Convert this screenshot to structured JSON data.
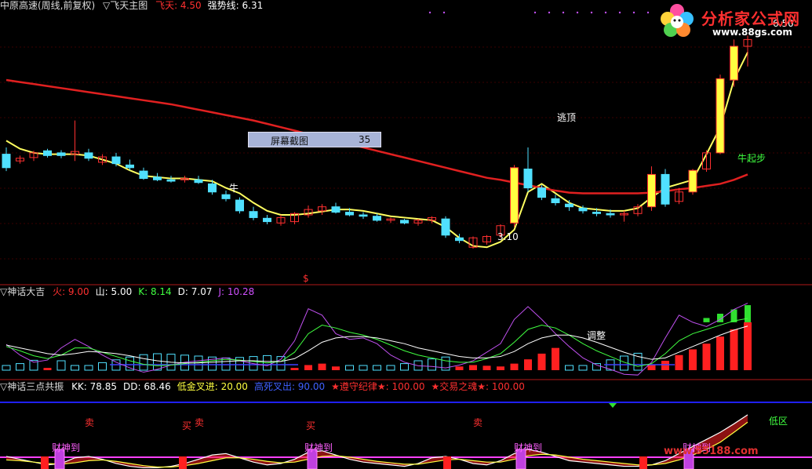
{
  "panel1": {
    "title": "中原高速(周线,前复权)",
    "indicator": "▽飞天主图",
    "fields": [
      {
        "label": "飞天:",
        "value": "4.50",
        "color": "#ff3030"
      },
      {
        "label": "强势线:",
        "value": "6.31",
        "color": "#ffffff"
      }
    ],
    "annotations": {
      "escape_top": "逃顶",
      "bull_start": "牛起步",
      "bull_mark": "牛",
      "low_price": "3.10",
      "high_price": "6.50"
    },
    "screenshot_button": {
      "label": "屏幕截图",
      "value": "35"
    },
    "marker": "$"
  },
  "panel2": {
    "title": "▽神话大吉",
    "fields": [
      {
        "label": "火:",
        "value": "9.00",
        "color": "#ff3030"
      },
      {
        "label": "山:",
        "value": "5.00",
        "color": "#ffffff"
      },
      {
        "label": "K:",
        "value": "8.14",
        "color": "#40ff40"
      },
      {
        "label": "D:",
        "value": "7.07",
        "color": "#ffffff"
      },
      {
        "label": "J:",
        "value": "10.28",
        "color": "#d050ff"
      }
    ],
    "annotation": "调整"
  },
  "panel3": {
    "title": "▽神话三点共振",
    "fields": [
      {
        "label": "KK:",
        "value": "78.85",
        "color": "#ffffff"
      },
      {
        "label": "DD:",
        "value": "68.46",
        "color": "#ffffff"
      },
      {
        "label": "低金叉进:",
        "value": "20.00",
        "color": "#ffff40"
      },
      {
        "label": "高死叉出:",
        "value": "90.00",
        "color": "#4060ff"
      },
      {
        "label": "★遵守纪律★:",
        "value": "100.00",
        "color": "#ff3030"
      },
      {
        "label": "★交易之魂★:",
        "value": "100.00",
        "color": "#ff3030"
      }
    ],
    "marks": {
      "sell": "卖",
      "buy": "买",
      "wealth": "财神到",
      "zone": "低区"
    }
  },
  "logo": {
    "name": "分析家公式网",
    "url": "www.88gs.com"
  },
  "watermark": "www.55188.com",
  "chart_data": [
    {
      "type": "candlestick",
      "title": "中原高速(周线,前复权)",
      "series": [
        {
          "name": "强势线",
          "color": "#ffff60",
          "values": [
            5.0,
            4.88,
            4.82,
            4.8,
            4.8,
            4.8,
            4.78,
            4.72,
            4.66,
            4.56,
            4.48,
            4.46,
            4.44,
            4.44,
            4.42,
            4.4,
            4.3,
            4.22,
            4.08,
            3.96,
            3.9,
            3.9,
            3.92,
            3.95,
            3.98,
            3.98,
            3.96,
            3.92,
            3.88,
            3.86,
            3.84,
            3.82,
            3.72,
            3.56,
            3.44,
            3.42,
            3.5,
            3.68,
            4.24,
            4.36,
            4.22,
            4.08,
            4.0,
            3.98,
            3.96,
            3.96,
            4.0,
            4.16,
            4.3,
            4.36,
            4.42,
            4.8,
            5.2,
            5.9,
            6.31
          ]
        },
        {
          "name": "飞天",
          "color": "#e02020",
          "values": [
            5.9,
            5.87,
            5.84,
            5.81,
            5.78,
            5.75,
            5.72,
            5.69,
            5.66,
            5.63,
            5.6,
            5.57,
            5.54,
            5.5,
            5.46,
            5.42,
            5.38,
            5.34,
            5.3,
            5.25,
            5.2,
            5.15,
            5.1,
            5.05,
            5.0,
            4.95,
            4.9,
            4.85,
            4.8,
            4.75,
            4.7,
            4.65,
            4.6,
            4.55,
            4.5,
            4.45,
            4.42,
            4.38,
            4.34,
            4.3,
            4.26,
            4.23,
            4.22,
            4.22,
            4.22,
            4.22,
            4.22,
            4.23,
            4.25,
            4.28,
            4.3,
            4.33,
            4.36,
            4.42,
            4.5
          ]
        }
      ],
      "candles": [
        [
          4.8,
          4.9,
          4.55,
          4.6
        ],
        [
          4.7,
          4.78,
          4.66,
          4.74
        ],
        [
          4.75,
          4.85,
          4.7,
          4.82
        ],
        [
          4.85,
          4.88,
          4.75,
          4.78
        ],
        [
          4.82,
          4.86,
          4.74,
          4.78
        ],
        [
          4.8,
          5.3,
          4.7,
          4.84
        ],
        [
          4.82,
          4.88,
          4.7,
          4.74
        ],
        [
          4.68,
          4.8,
          4.64,
          4.76
        ],
        [
          4.76,
          4.82,
          4.62,
          4.66
        ],
        [
          4.64,
          4.72,
          4.56,
          4.6
        ],
        [
          4.55,
          4.6,
          4.42,
          4.44
        ],
        [
          4.46,
          4.52,
          4.4,
          4.42
        ],
        [
          4.42,
          4.48,
          4.38,
          4.4
        ],
        [
          4.42,
          4.48,
          4.38,
          4.44
        ],
        [
          4.42,
          4.48,
          4.36,
          4.38
        ],
        [
          4.36,
          4.42,
          4.2,
          4.24
        ],
        [
          4.2,
          4.26,
          4.1,
          4.14
        ],
        [
          4.12,
          4.16,
          3.92,
          3.96
        ],
        [
          3.95,
          4.02,
          3.82,
          3.86
        ],
        [
          3.85,
          3.9,
          3.76,
          3.8
        ],
        [
          3.78,
          3.9,
          3.74,
          3.86
        ],
        [
          3.8,
          3.94,
          3.76,
          3.92
        ],
        [
          3.9,
          4.04,
          3.86,
          3.98
        ],
        [
          3.96,
          4.06,
          3.9,
          4.02
        ],
        [
          4.02,
          4.08,
          3.92,
          3.94
        ],
        [
          3.94,
          4.0,
          3.88,
          3.9
        ],
        [
          3.9,
          3.94,
          3.84,
          3.88
        ],
        [
          3.88,
          3.92,
          3.8,
          3.82
        ],
        [
          3.82,
          3.86,
          3.78,
          3.84
        ],
        [
          3.82,
          3.84,
          3.76,
          3.78
        ],
        [
          3.78,
          3.84,
          3.74,
          3.82
        ],
        [
          3.82,
          3.88,
          3.78,
          3.86
        ],
        [
          3.84,
          3.88,
          3.56,
          3.6
        ],
        [
          3.56,
          3.62,
          3.48,
          3.52
        ],
        [
          3.42,
          3.58,
          3.4,
          3.56
        ],
        [
          3.5,
          3.6,
          3.46,
          3.58
        ],
        [
          3.6,
          3.76,
          3.56,
          3.74
        ],
        [
          3.78,
          4.64,
          3.72,
          4.6
        ],
        [
          4.58,
          4.9,
          4.24,
          4.3
        ],
        [
          4.3,
          4.34,
          4.12,
          4.16
        ],
        [
          4.14,
          4.2,
          4.04,
          4.08
        ],
        [
          4.06,
          4.12,
          3.96,
          4.02
        ],
        [
          4.0,
          4.04,
          3.92,
          3.96
        ],
        [
          3.94,
          4.0,
          3.88,
          3.92
        ],
        [
          3.92,
          3.98,
          3.86,
          3.9
        ],
        [
          3.9,
          3.96,
          3.8,
          3.92
        ],
        [
          3.92,
          4.06,
          3.88,
          4.02
        ],
        [
          4.02,
          4.62,
          3.96,
          4.5
        ],
        [
          4.5,
          4.58,
          4.02,
          4.06
        ],
        [
          4.1,
          4.3,
          4.06,
          4.24
        ],
        [
          4.24,
          4.58,
          4.2,
          4.56
        ],
        [
          4.58,
          4.86,
          4.54,
          4.82
        ],
        [
          4.82,
          5.98,
          4.8,
          5.92
        ],
        [
          5.9,
          6.5,
          5.8,
          6.4
        ],
        [
          6.4,
          6.56,
          6.1,
          6.5
        ]
      ],
      "ylim": [
        2.9,
        6.9
      ]
    },
    {
      "type": "bar",
      "title": "▽神话大吉",
      "series": [
        {
          "name": "J",
          "color": "#c050f0",
          "values": [
            4.5,
            3.0,
            2.0,
            2.3,
            4.0,
            5.2,
            4.2,
            3.0,
            2.0,
            1.2,
            0.6,
            1.0,
            1.6,
            2.0,
            2.2,
            2.4,
            2.6,
            2.2,
            1.8,
            1.5,
            2.4,
            5.0,
            9.5,
            8.6,
            6.0,
            5.2,
            5.4,
            4.6,
            3.0,
            2.0,
            1.5,
            1.4,
            1.2,
            1.6,
            2.2,
            3.4,
            4.6,
            8.0,
            9.8,
            8.0,
            6.0,
            4.2,
            2.6,
            1.6,
            1.0,
            0.3,
            0.2,
            2.0,
            5.4,
            8.6,
            7.6,
            7.0,
            8.0,
            9.4,
            10.28
          ]
        },
        {
          "name": "K",
          "color": "#40ff40",
          "values": [
            4.2,
            3.6,
            2.9,
            2.5,
            3.0,
            4.0,
            4.0,
            3.4,
            2.8,
            2.2,
            1.7,
            1.5,
            1.6,
            1.8,
            2.0,
            2.2,
            2.4,
            2.3,
            2.1,
            1.9,
            2.1,
            3.4,
            6.0,
            7.2,
            6.8,
            6.2,
            5.8,
            5.2,
            4.4,
            3.6,
            3.0,
            2.6,
            2.2,
            2.0,
            2.0,
            2.5,
            3.2,
            4.8,
            6.6,
            7.2,
            6.8,
            5.8,
            4.6,
            3.6,
            2.8,
            2.0,
            1.4,
            1.8,
            3.2,
            5.0,
            6.0,
            6.6,
            7.2,
            7.8,
            8.14
          ]
        },
        {
          "name": "D",
          "color": "#ffffff",
          "values": [
            4.4,
            4.0,
            3.6,
            3.2,
            3.0,
            3.2,
            3.5,
            3.4,
            3.2,
            2.9,
            2.5,
            2.2,
            2.0,
            1.9,
            1.9,
            2.0,
            2.1,
            2.2,
            2.2,
            2.1,
            2.1,
            2.5,
            3.6,
            4.8,
            5.4,
            5.6,
            5.6,
            5.4,
            5.0,
            4.6,
            4.0,
            3.6,
            3.2,
            2.8,
            2.6,
            2.6,
            2.8,
            3.5,
            4.6,
            5.4,
            5.8,
            5.8,
            5.4,
            4.8,
            4.1,
            3.4,
            2.8,
            2.4,
            2.6,
            3.4,
            4.2,
            5.0,
            5.8,
            6.5,
            7.07
          ]
        },
        {
          "name": "火",
          "color": "#ff2020",
          "values": [
            0,
            0,
            0,
            1.2,
            0,
            0,
            0,
            0,
            0,
            0,
            0,
            0,
            0,
            0,
            0,
            0,
            0,
            0,
            0,
            0,
            0,
            1.2,
            1.6,
            1.8,
            1.4,
            0,
            0,
            0,
            0,
            0,
            0,
            0,
            0,
            1.4,
            1.6,
            1.5,
            1.4,
            1.8,
            2.4,
            3.2,
            4.0,
            0,
            0,
            0,
            0,
            0,
            0,
            1.6,
            2.2,
            3.0,
            3.8,
            4.6,
            5.6,
            6.6,
            7.6
          ]
        }
      ],
      "ylim": [
        0,
        11
      ]
    },
    {
      "type": "line",
      "title": "▽神话三点共振",
      "series": [
        {
          "name": "KK",
          "color": "#ffffff",
          "values": [
            20,
            16,
            12,
            8,
            10,
            18,
            20,
            16,
            10,
            6,
            4,
            4,
            6,
            10,
            16,
            22,
            24,
            18,
            12,
            8,
            10,
            16,
            26,
            28,
            22,
            16,
            12,
            10,
            8,
            6,
            10,
            18,
            20,
            16,
            10,
            8,
            14,
            24,
            30,
            26,
            20,
            14,
            12,
            10,
            8,
            6,
            6,
            8,
            14,
            24,
            34,
            44,
            54,
            66,
            78.85
          ]
        },
        {
          "name": "DD",
          "color": "#ffff40",
          "values": [
            15,
            14,
            12,
            10,
            9,
            11,
            14,
            15,
            13,
            10,
            7,
            5,
            5,
            7,
            10,
            14,
            18,
            18,
            16,
            13,
            11,
            12,
            16,
            20,
            21,
            19,
            16,
            13,
            11,
            9,
            9,
            12,
            15,
            16,
            14,
            12,
            12,
            16,
            21,
            23,
            22,
            19,
            16,
            14,
            12,
            10,
            8,
            8,
            10,
            15,
            22,
            30,
            40,
            54,
            68.46
          ]
        },
        {
          "name": "低金叉进",
          "color": "#ff40ff",
          "values": [
            20,
            20,
            20,
            20,
            20,
            20,
            20,
            20,
            20,
            20,
            20,
            20,
            20,
            20,
            20,
            20,
            20,
            20,
            20,
            20,
            20,
            20,
            20,
            20,
            20,
            20,
            20,
            20,
            20,
            20,
            20,
            20,
            20,
            20,
            20,
            20,
            20,
            20,
            20,
            20,
            20,
            20,
            20,
            20,
            20,
            20,
            20,
            20,
            20,
            20,
            20,
            20,
            20,
            20,
            20
          ]
        },
        {
          "name": "高死叉出",
          "color": "#2020ff",
          "values": [
            90,
            90,
            90,
            90,
            90,
            90,
            90,
            90,
            90,
            90,
            90,
            90,
            90,
            90,
            90,
            90,
            90,
            90,
            90,
            90,
            90,
            90,
            90,
            90,
            90,
            90,
            90,
            90,
            90,
            90,
            90,
            90,
            90,
            90,
            90,
            90,
            90,
            90,
            90,
            90,
            90,
            90,
            90,
            90,
            90,
            90,
            90,
            90,
            90,
            90,
            90,
            90,
            90,
            90,
            90
          ]
        }
      ],
      "ylim": [
        0,
        100
      ]
    }
  ]
}
